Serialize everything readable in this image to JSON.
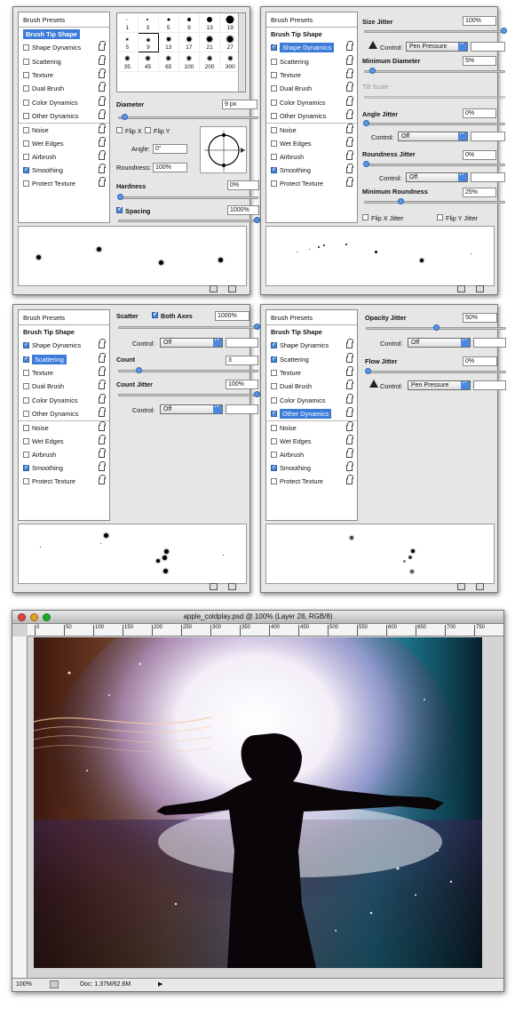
{
  "brush_panel": {
    "presets_label": "Brush Presets",
    "options": [
      {
        "label": "Brush Tip Shape",
        "checkbox": false,
        "lock": false
      },
      {
        "label": "Shape Dynamics",
        "checkbox": true,
        "lock": true
      },
      {
        "label": "Scattering",
        "checkbox": true,
        "lock": true
      },
      {
        "label": "Texture",
        "checkbox": true,
        "lock": true
      },
      {
        "label": "Dual Brush",
        "checkbox": true,
        "lock": true
      },
      {
        "label": "Color Dynamics",
        "checkbox": true,
        "lock": true
      },
      {
        "label": "Other Dynamics",
        "checkbox": true,
        "lock": true
      },
      {
        "label": "Noise",
        "checkbox": true,
        "lock": true
      },
      {
        "label": "Wet Edges",
        "checkbox": true,
        "lock": true
      },
      {
        "label": "Airbrush",
        "checkbox": true,
        "lock": true
      },
      {
        "label": "Smoothing",
        "checkbox": true,
        "lock": true
      },
      {
        "label": "Protect Texture",
        "checkbox": true,
        "lock": true
      }
    ],
    "panels": [
      {
        "selected": 0,
        "checked": [
          10
        ]
      },
      {
        "selected": 1,
        "checked": [
          1,
          10
        ]
      },
      {
        "selected": 2,
        "checked": [
          1,
          2,
          10
        ]
      },
      {
        "selected": 6,
        "checked": [
          1,
          2,
          6,
          10
        ]
      }
    ]
  },
  "tip": {
    "brush_sizes": [
      "1",
      "3",
      "5",
      "9",
      "13",
      "19",
      "5",
      "9",
      "13",
      "17",
      "21",
      "27",
      "35",
      "45",
      "65",
      "100",
      "200",
      "300"
    ],
    "diameter_label": "Diameter",
    "diameter_value": "9 px",
    "flip_x": "Flip X",
    "flip_y": "Flip Y",
    "angle_label": "Angle:",
    "angle_value": "0°",
    "roundness_label": "Roundness:",
    "roundness_value": "100%",
    "hardness_label": "Hardness",
    "hardness_value": "0%",
    "spacing_label": "Spacing",
    "spacing_value": "1000%"
  },
  "shape": {
    "size_jitter_label": "Size Jitter",
    "size_jitter_value": "100%",
    "control_label": "Control:",
    "control_pen": "Pen Pressure",
    "control_off": "Off",
    "min_diameter_label": "Minimum Diameter",
    "min_diameter_value": "5%",
    "tilt_scale_label": "Tilt Scale",
    "angle_jitter_label": "Angle Jitter",
    "angle_jitter_value": "0%",
    "roundness_jitter_label": "Roundness Jitter",
    "roundness_jitter_value": "0%",
    "min_roundness_label": "Minimum Roundness",
    "min_roundness_value": "25%",
    "flip_x_jitter": "Flip X Jitter",
    "flip_y_jitter": "Flip Y Jitter"
  },
  "scatter": {
    "scatter_label": "Scatter",
    "both_axes": "Both Axes",
    "scatter_value": "1000%",
    "control_label": "Control:",
    "control_off": "Off",
    "count_label": "Count",
    "count_value": "3",
    "count_jitter_label": "Count Jitter",
    "count_jitter_value": "100%"
  },
  "other": {
    "opacity_jitter_label": "Opacity Jitter",
    "opacity_jitter_value": "50%",
    "control_label": "Control:",
    "control_off": "Off",
    "control_pen": "Pen Pressure",
    "flow_jitter_label": "Flow Jitter",
    "flow_jitter_value": "0%"
  },
  "document": {
    "title": "apple_coldplay.psd @ 100% (Layer 28, RGB/8)",
    "ruler_ticks": [
      "0",
      "50",
      "100",
      "150",
      "200",
      "250",
      "300",
      "350",
      "400",
      "450",
      "500",
      "550",
      "600",
      "650",
      "700",
      "750"
    ],
    "zoom": "100%",
    "doc_size": "Doc: 1.37M/62.6M"
  },
  "colors": {
    "accent": "#3b7bd9",
    "close": "#e0443e",
    "minimize": "#dea123",
    "zoom": "#1aab29"
  }
}
